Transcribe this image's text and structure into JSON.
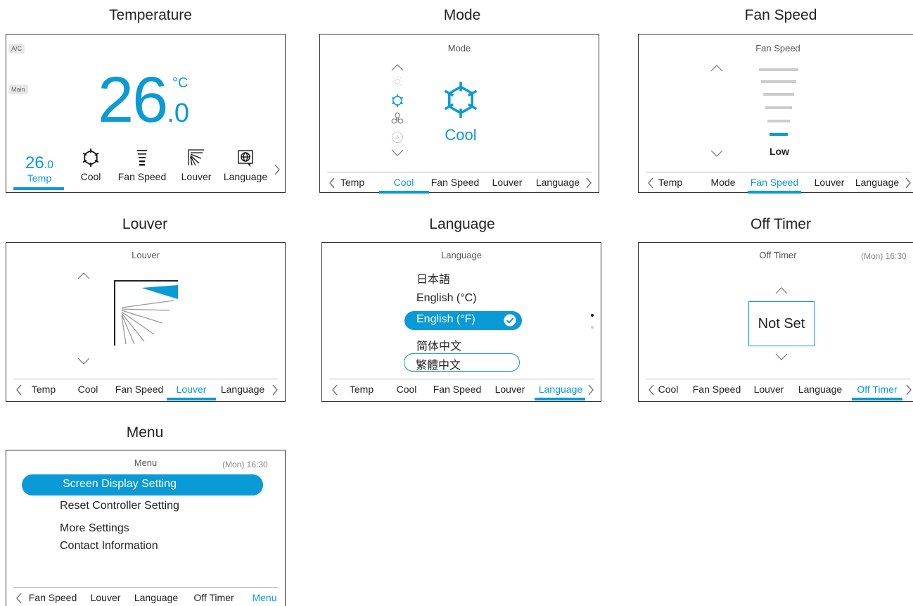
{
  "titles": {
    "temperature": "Temperature",
    "mode": "Mode",
    "fan_speed": "Fan Speed",
    "louver": "Louver",
    "language": "Language",
    "off_timer": "Off Timer",
    "menu": "Menu"
  },
  "temperature": {
    "tag_ac": "A/C",
    "tag_main": "Main",
    "big_int": "26",
    "big_dec": ".0",
    "unit": "°C",
    "bottom_items": [
      {
        "value_int": "26",
        "value_dec": ".0",
        "label": "Temp",
        "active": true
      },
      {
        "icon": "snowflake-icon",
        "label": "Cool"
      },
      {
        "icon": "fan-speed-icon",
        "label": "Fan Speed"
      },
      {
        "icon": "louver-icon",
        "label": "Louver"
      },
      {
        "icon": "globe-icon",
        "label": "Language"
      }
    ],
    "accent": "#0a9ad6"
  },
  "mode": {
    "header": "Mode",
    "mode_icons": [
      "sun-icon",
      "snowflake-icon",
      "fan-icon",
      "auto-icon"
    ],
    "selected_label": "Cool",
    "nav": [
      "Temp",
      "Cool",
      "Fan Speed",
      "Louver",
      "Language"
    ],
    "active": "Cool"
  },
  "fan_speed": {
    "header": "Fan Speed",
    "level_label": "Low",
    "levels_total": 6,
    "level_current": 1,
    "nav": [
      "Temp",
      "Mode",
      "Fan Speed",
      "Louver",
      "Language"
    ],
    "active": "Fan Speed"
  },
  "louver": {
    "header": "Louver",
    "nav": [
      "Temp",
      "Cool",
      "Fan Speed",
      "Louver",
      "Language"
    ],
    "active": "Louver"
  },
  "language": {
    "header": "Language",
    "options": [
      "日本語",
      "English (°C)",
      "English (°F)",
      "简体中文",
      "繁體中文"
    ],
    "selected": "English (°F)",
    "nav": [
      "Temp",
      "Cool",
      "Fan Speed",
      "Louver",
      "Language"
    ],
    "active": "Language"
  },
  "off_timer": {
    "header": "Off Timer",
    "clock": "(Mon) 16:30",
    "value": "Not Set",
    "nav": [
      "Cool",
      "Fan Speed",
      "Louver",
      "Language",
      "Off Timer"
    ],
    "active": "Off Timer"
  },
  "menu": {
    "header": "Menu",
    "clock": "(Mon) 16:30",
    "items": [
      "Screen Display Setting",
      "Reset Controller Setting",
      "More Settings",
      "Contact Information"
    ],
    "selected": "Screen Display Setting",
    "nav": [
      "Fan Speed",
      "Louver",
      "Language",
      "Off Timer",
      "Menu"
    ],
    "active": "Menu"
  }
}
